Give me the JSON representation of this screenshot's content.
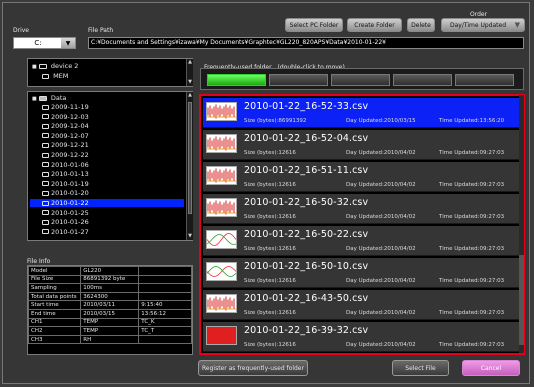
{
  "header": {
    "drive_label": "Drive",
    "drive_value": "C:",
    "file_path_label": "File Path",
    "file_path_value": "C:¥Documents and Settings¥izawa¥My Documents¥Graphtec¥GL220_820APS¥Data¥2010-01-22¥",
    "select_pc_folder": "Select PC Folder",
    "create_folder": "Create Folder",
    "delete": "Delete",
    "order_label": "Order",
    "order_value": "Day/Time Updated"
  },
  "tree": {
    "device": "device 2",
    "mem": "MEM",
    "data": "Data",
    "folders": [
      "2009-11-19",
      "2009-12-03",
      "2009-12-04",
      "2009-12-07",
      "2009-12-21",
      "2009-12-22",
      "2010-01-06",
      "2010-01-13",
      "2010-01-19",
      "2010-01-20",
      "2010-01-22",
      "2010-01-25",
      "2010-01-26",
      "2010-01-27"
    ],
    "selected_index": 10
  },
  "file_info": {
    "label": "File Info",
    "rows": [
      [
        "Model",
        "GL220",
        ""
      ],
      [
        "File Size",
        "86891392 byte",
        ""
      ],
      [
        "Sampling",
        "100ms",
        ""
      ],
      [
        "Total data points",
        "3624300",
        ""
      ],
      [
        "Start time",
        "2010/03/11",
        "9:15:40"
      ],
      [
        "End time",
        "2010/03/15",
        "13:56:12"
      ],
      [
        "CH1",
        "TEMP",
        "TC_K"
      ],
      [
        "CH2",
        "TEMP",
        "TC_T"
      ],
      [
        "CH3",
        "RH",
        ""
      ]
    ]
  },
  "favorites": {
    "label": "Frequently-used folder　(double-click to move)"
  },
  "files": [
    {
      "name": "2010-01-22_16-52-33.csv",
      "size": "Size (bytes):86991392",
      "day": "Day Updated:2010/03/15",
      "time": "Time Updated:13:56:20",
      "thumb": "red-wave",
      "selected": true
    },
    {
      "name": "2010-01-22_16-52-04.csv",
      "size": "Size (bytes):12616",
      "day": "Day Updated:2010/04/02",
      "time": "Time Updated:09:27:03",
      "thumb": "red-wave",
      "selected": false
    },
    {
      "name": "2010-01-22_16-51-11.csv",
      "size": "Size (bytes):12616",
      "day": "Day Updated:2010/04/02",
      "time": "Time Updated:09:27:03",
      "thumb": "red-wave",
      "selected": false
    },
    {
      "name": "2010-01-22_16-50-32.csv",
      "size": "Size (bytes):12616",
      "day": "Day Updated:2010/04/02",
      "time": "Time Updated:09:27:03",
      "thumb": "red-wave",
      "selected": false
    },
    {
      "name": "2010-01-22_16-50-22.csv",
      "size": "Size (bytes):12616",
      "day": "Day Updated:2010/04/02",
      "time": "Time Updated:09:27:03",
      "thumb": "sine",
      "selected": false
    },
    {
      "name": "2010-01-22_16-50-10.csv",
      "size": "Size (bytes):12616",
      "day": "Day Updated:2010/04/02",
      "time": "Time Updated:09:27:03",
      "thumb": "sine2",
      "selected": false
    },
    {
      "name": "2010-01-22_16-43-50.csv",
      "size": "Size (bytes):12616",
      "day": "Day Updated:2010/04/02",
      "time": "Time Updated:09:27:03",
      "thumb": "red-wave",
      "selected": false
    },
    {
      "name": "2010-01-22_16-39-32.csv",
      "size": "Size (bytes):12616",
      "day": "Day Updated:2010/04/02",
      "time": "Time Updated:09:27:03",
      "thumb": "solid-red",
      "selected": false
    }
  ],
  "footer": {
    "register": "Register as frequently-used folder",
    "select_file": "Select File",
    "cancel": "Cancel"
  },
  "colors": {
    "selection": "#0b21f5",
    "list_border": "#e4001b",
    "favorite_active": "#2fd21f",
    "cancel_button": "#d977d0"
  }
}
